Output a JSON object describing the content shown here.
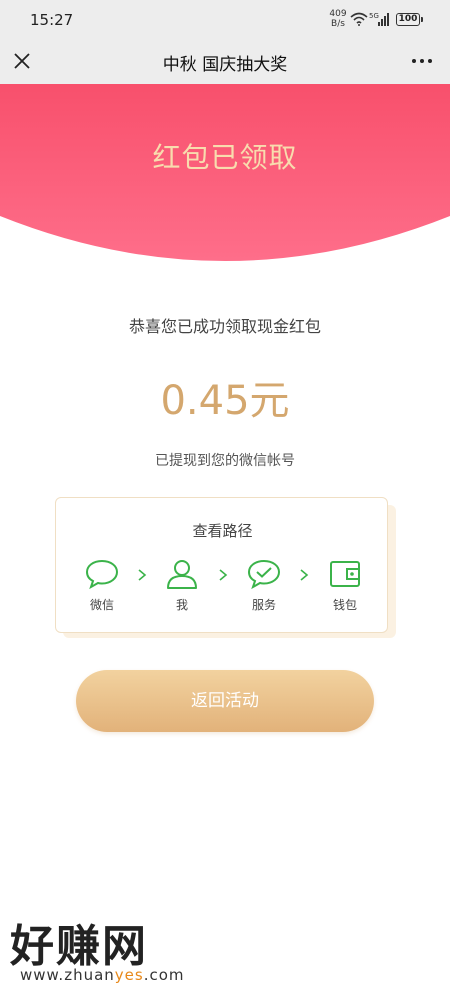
{
  "status_bar": {
    "time": "15:27",
    "net_speed_value": "409",
    "net_speed_unit": "B/s",
    "battery": "100"
  },
  "nav": {
    "title": "中秋 国庆抽大奖",
    "close_icon": "close-icon",
    "more_icon": "more-icon"
  },
  "banner": {
    "title": "红包已领取",
    "color_top": "#f8506c",
    "color_bottom": "#fe6e8a",
    "title_color": "#f8dcae"
  },
  "main": {
    "congrats_text": "恭喜您已成功领取现金红包",
    "amount": "0.45元",
    "amount_color": "#d4a76e",
    "withdraw_note": "已提现到您的微信帐号"
  },
  "path_card": {
    "title": "查看路径",
    "steps": [
      {
        "label": "微信",
        "icon": "chat-bubble-icon"
      },
      {
        "label": "我",
        "icon": "person-icon"
      },
      {
        "label": "服务",
        "icon": "check-bubble-icon"
      },
      {
        "label": "钱包",
        "icon": "wallet-icon"
      }
    ],
    "icon_color": "#3bb34a"
  },
  "back_button": {
    "label": "返回活动"
  },
  "watermark": {
    "logo": "好赚网",
    "url_prefix": "www.zhuan",
    "url_highlight": "yes",
    "url_suffix": ".com"
  }
}
